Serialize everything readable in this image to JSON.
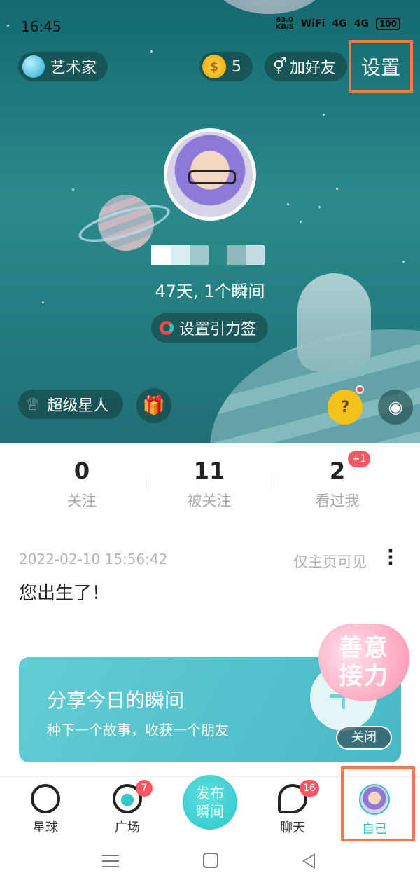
{
  "statusbar": {
    "time": "16:45",
    "net_speed": "63.0",
    "net_unit": "KB/S",
    "wifi": "WiFi",
    "sim1": "4G",
    "sim2": "4G",
    "battery": "100"
  },
  "header": {
    "artist_label": "艺术家",
    "coins_value": "5",
    "add_friend_label": "加好友",
    "settings_label": "设置"
  },
  "profile": {
    "days_text": "47天, 1个瞬间",
    "gravity_tag_label": "设置引力签"
  },
  "actions": {
    "superstar_label": "超级星人",
    "cat_icon_text": "?"
  },
  "stats": [
    {
      "value": "0",
      "label": "关注"
    },
    {
      "value": "11",
      "label": "被关注"
    },
    {
      "value": "2",
      "label": "看过我",
      "badge": "+1"
    }
  ],
  "post": {
    "date": "2022-02-10 15:56:42",
    "visibility": "仅主页可见",
    "text": "您出生了！"
  },
  "share_banner": {
    "title": "分享今日的瞬间",
    "subtitle": "种下一个故事，收获一个朋友",
    "plus": "+",
    "heart_text": "善意接力",
    "close_label": "关闭"
  },
  "bottom_nav": {
    "planet_label": "星球",
    "square_label": "广场",
    "square_badge": "7",
    "publish_label": "发布瞬间",
    "chat_label": "聊天",
    "chat_badge": "16",
    "self_label": "自己"
  },
  "colors": {
    "accent": "#35c0c0",
    "badge": "#ff5563",
    "highlight_box": "#f07a4b"
  }
}
